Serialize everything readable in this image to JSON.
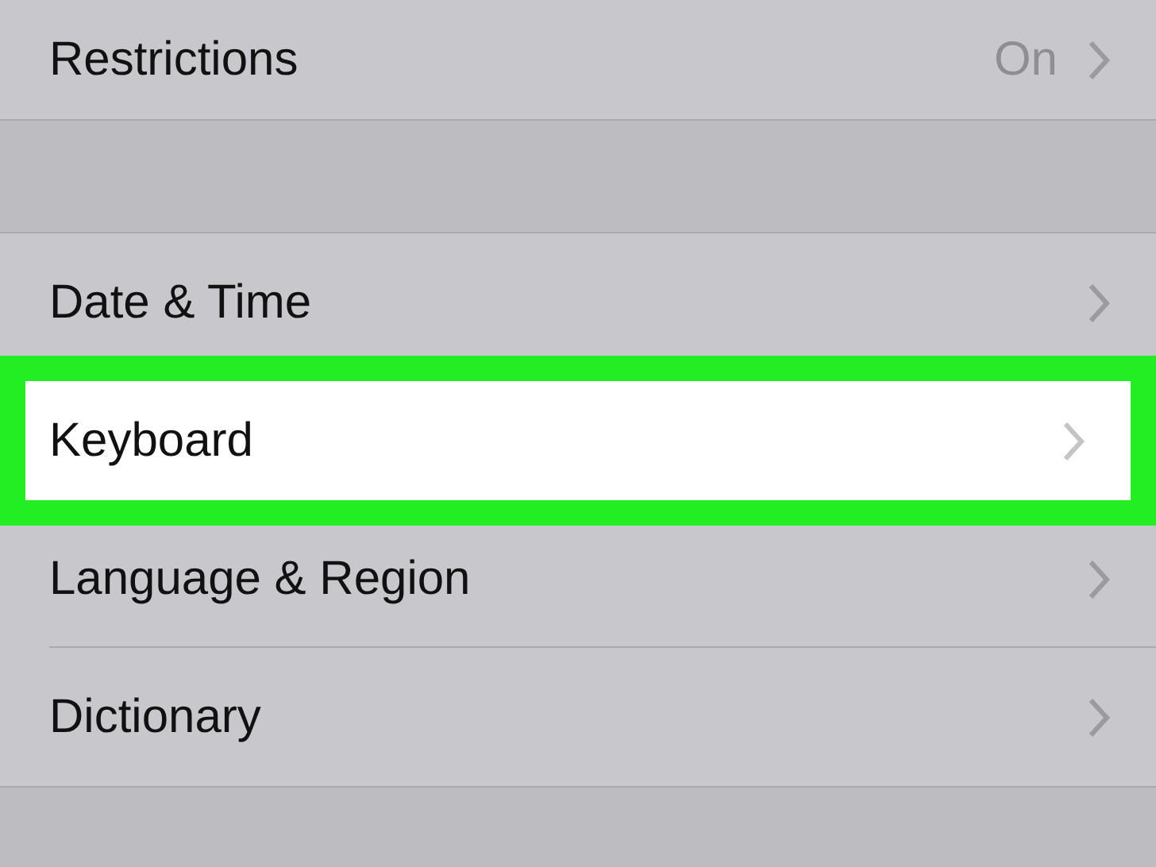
{
  "groups": [
    {
      "rows": [
        {
          "label": "Restrictions",
          "value": "On",
          "selected": false
        }
      ]
    },
    {
      "rows": [
        {
          "label": "Date & Time",
          "selected": false
        },
        {
          "label": "Keyboard",
          "selected": true
        },
        {
          "label": "Language & Region",
          "selected": false
        },
        {
          "label": "Dictionary",
          "selected": false
        }
      ]
    }
  ]
}
